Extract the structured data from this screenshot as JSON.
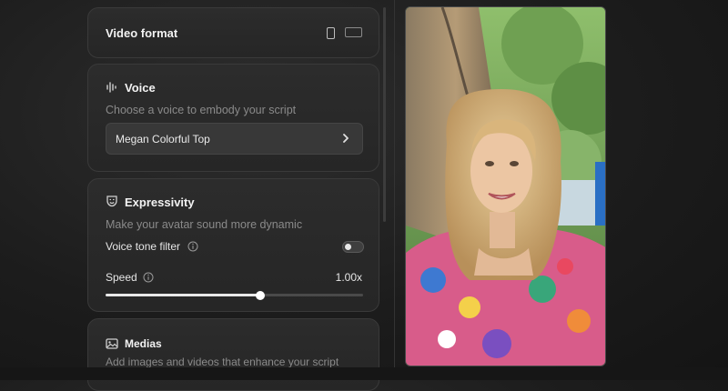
{
  "video_format": {
    "title": "Video format"
  },
  "voice": {
    "title": "Voice",
    "subtitle": "Choose a voice to embody your script",
    "selected": "Megan Colorful Top"
  },
  "expressivity": {
    "title": "Expressivity",
    "subtitle": "Make your avatar sound more dynamic",
    "tone_filter_label": "Voice tone filter",
    "tone_filter_on": false,
    "speed_label": "Speed",
    "speed_value": "1.00x",
    "speed_fraction": 0.6
  },
  "medias": {
    "title": "Medias",
    "subtitle": "Add images and videos that enhance your script"
  },
  "icons": {
    "voice": "waveform-icon",
    "expressivity": "theater-mask-icon",
    "medias": "image-icon",
    "info": "info-icon",
    "select": "chevron-right-icon",
    "portrait": "portrait-format-icon",
    "landscape": "landscape-format-icon"
  }
}
